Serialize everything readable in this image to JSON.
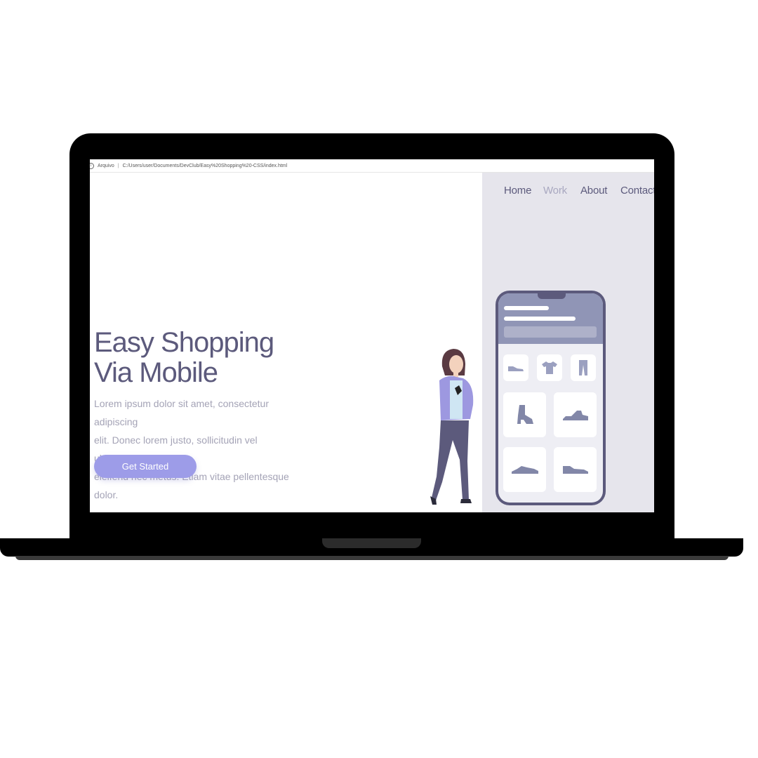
{
  "browser": {
    "label": "Arquivo",
    "url": "C:/Users/user/Documents/DevClub/Easy%20Shopping%20-CSS/index.html"
  },
  "nav": {
    "items": [
      {
        "label": "Home",
        "active": false
      },
      {
        "label": "Work",
        "active": true
      },
      {
        "label": "About",
        "active": false
      },
      {
        "label": "Contact",
        "active": false
      }
    ]
  },
  "hero": {
    "title_line1": "Easy Shopping",
    "title_line2": "Via Mobile",
    "text_line1": "Lorem ipsum dolor sit amet, consectetur adipiscing",
    "text_line2": "elit. Donec lorem justo, sollicitudin vel ultriciessed,",
    "text_line3": "eleifend nec metus. Etiam vitae pellentesque dolor.",
    "cta_label": "Get Started"
  },
  "colors": {
    "primary_text": "#5c5a7c",
    "muted_text": "#a4a3b6",
    "accent": "#9d9ce8",
    "panel": "#e6e5ec"
  },
  "illustration": {
    "phone_products": [
      "sneaker-icon",
      "tshirt-icon",
      "pants-icon",
      "boot-icon",
      "running-shoe-icon",
      "shoe-icon",
      "sneaker-icon"
    ]
  }
}
